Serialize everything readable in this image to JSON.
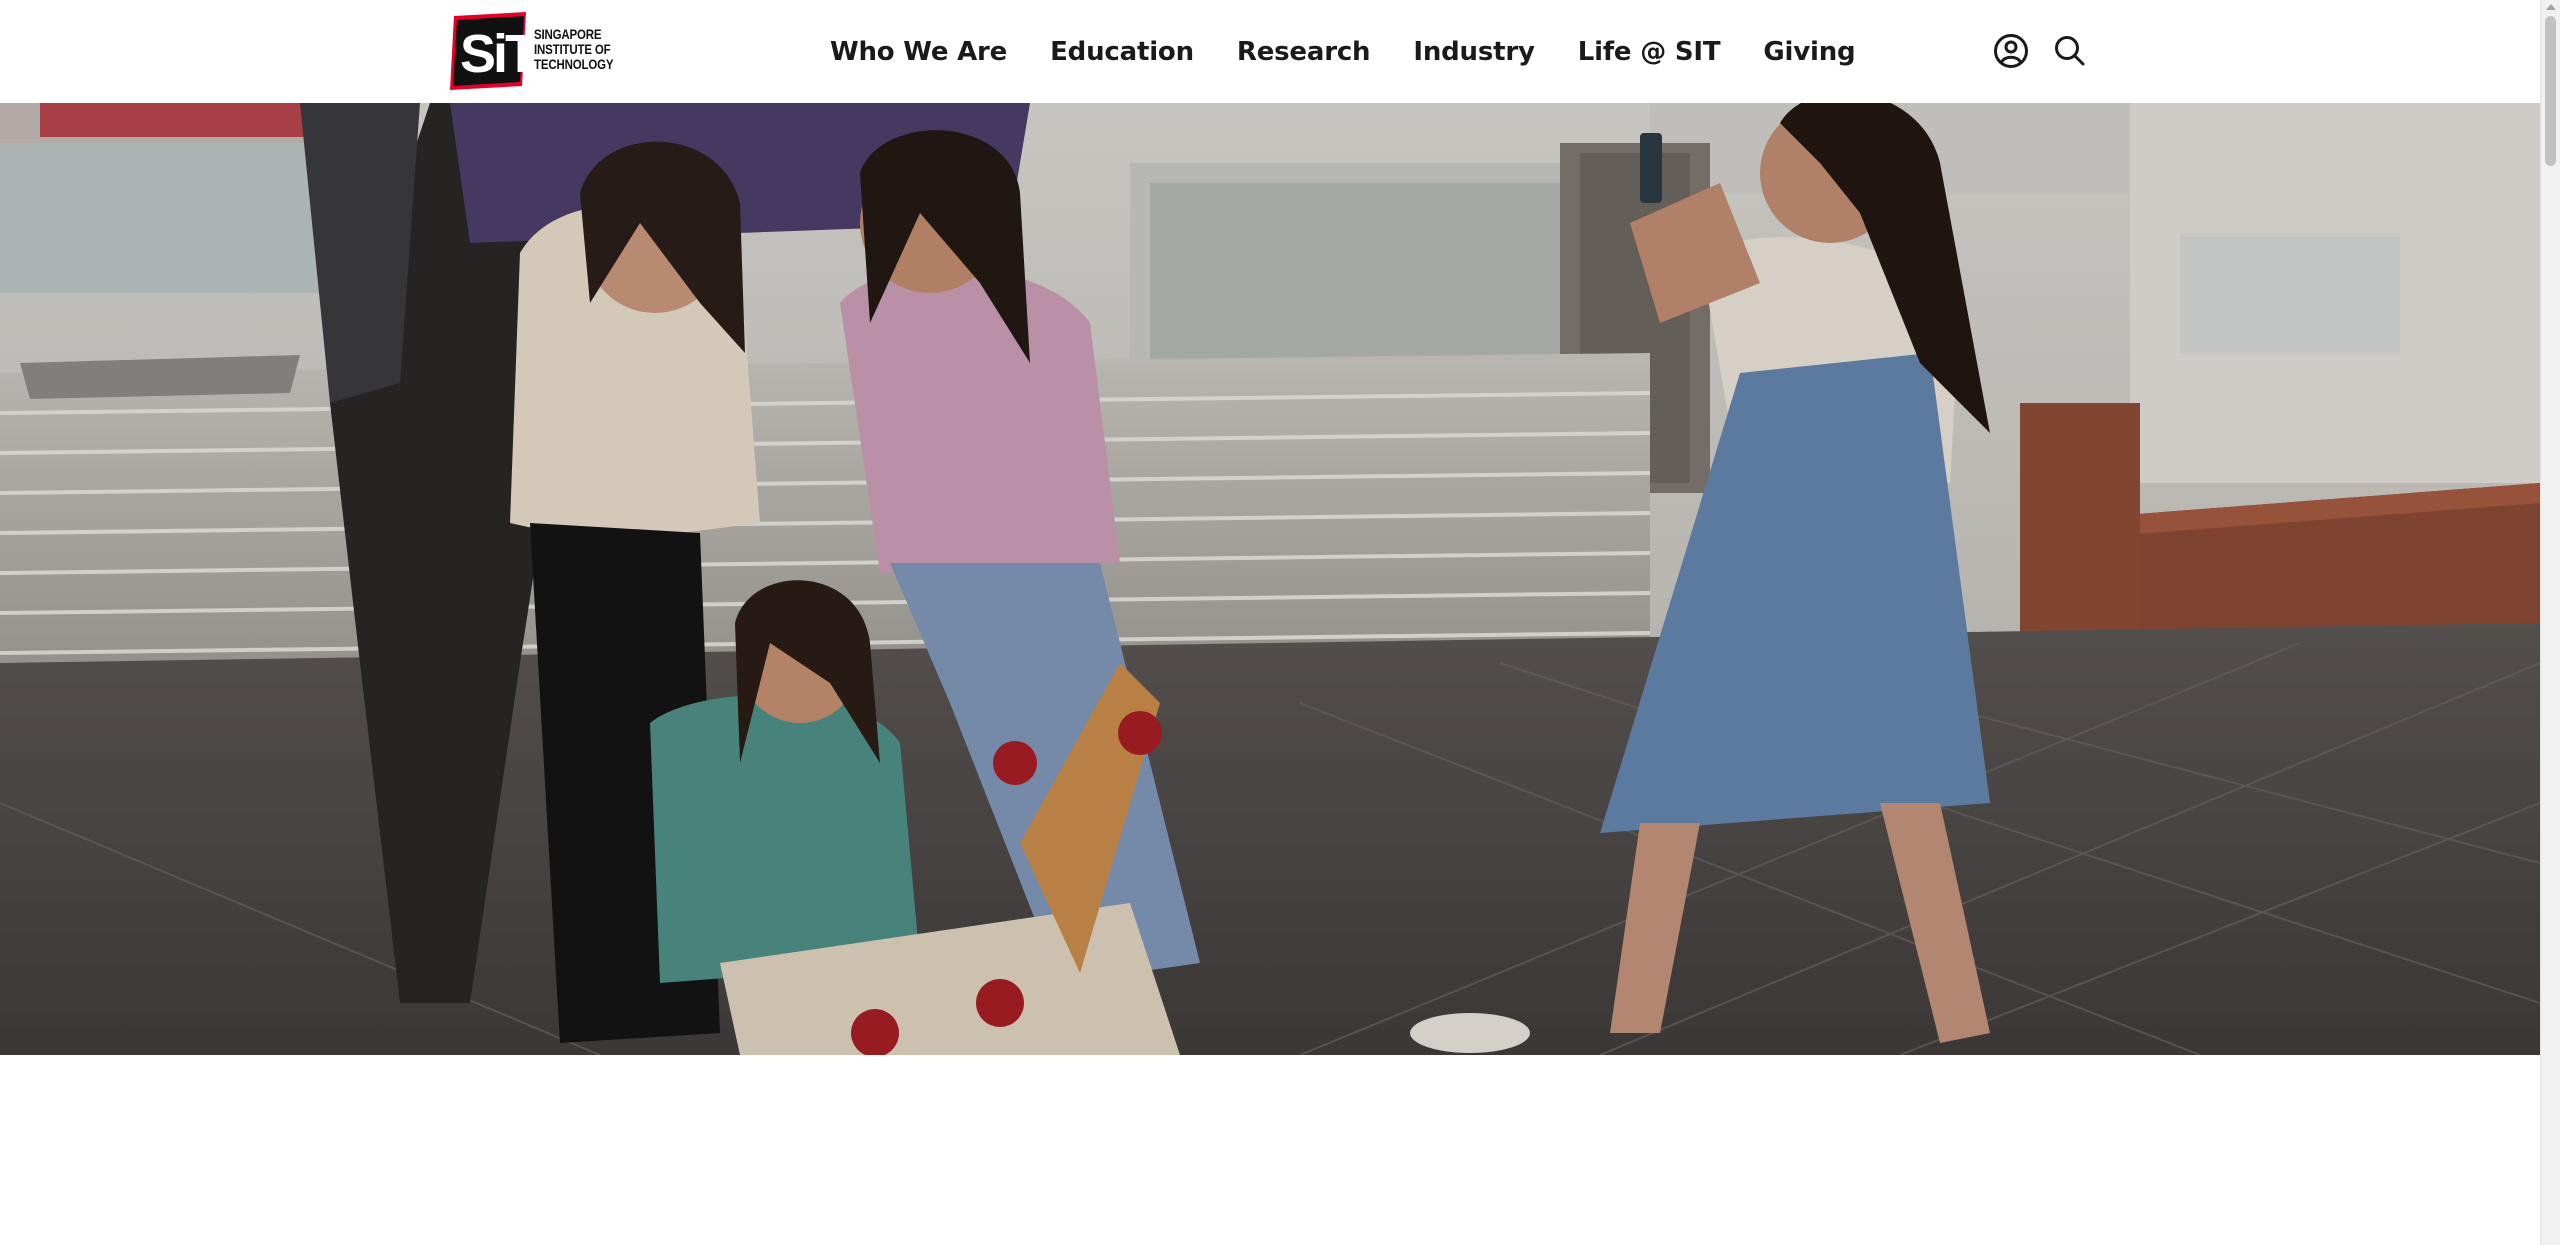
{
  "brand": {
    "name": "Singapore Institute of Technology",
    "logo_mark": "SiT",
    "logo_lines": [
      "SINGAPORE",
      "INSTITUTE OF",
      "TECHNOLOGY"
    ],
    "accent_color": "#e4002b"
  },
  "nav": {
    "items": [
      {
        "label": "Who We Are"
      },
      {
        "label": "Education"
      },
      {
        "label": "Research"
      },
      {
        "label": "Industry"
      },
      {
        "label": "Life @ SIT"
      },
      {
        "label": "Giving"
      }
    ]
  },
  "header_icons": {
    "account": "account-icon",
    "search": "search-icon"
  },
  "hero": {
    "image_alt": "Students posing with a longboard on campus while a friend takes a photo"
  }
}
